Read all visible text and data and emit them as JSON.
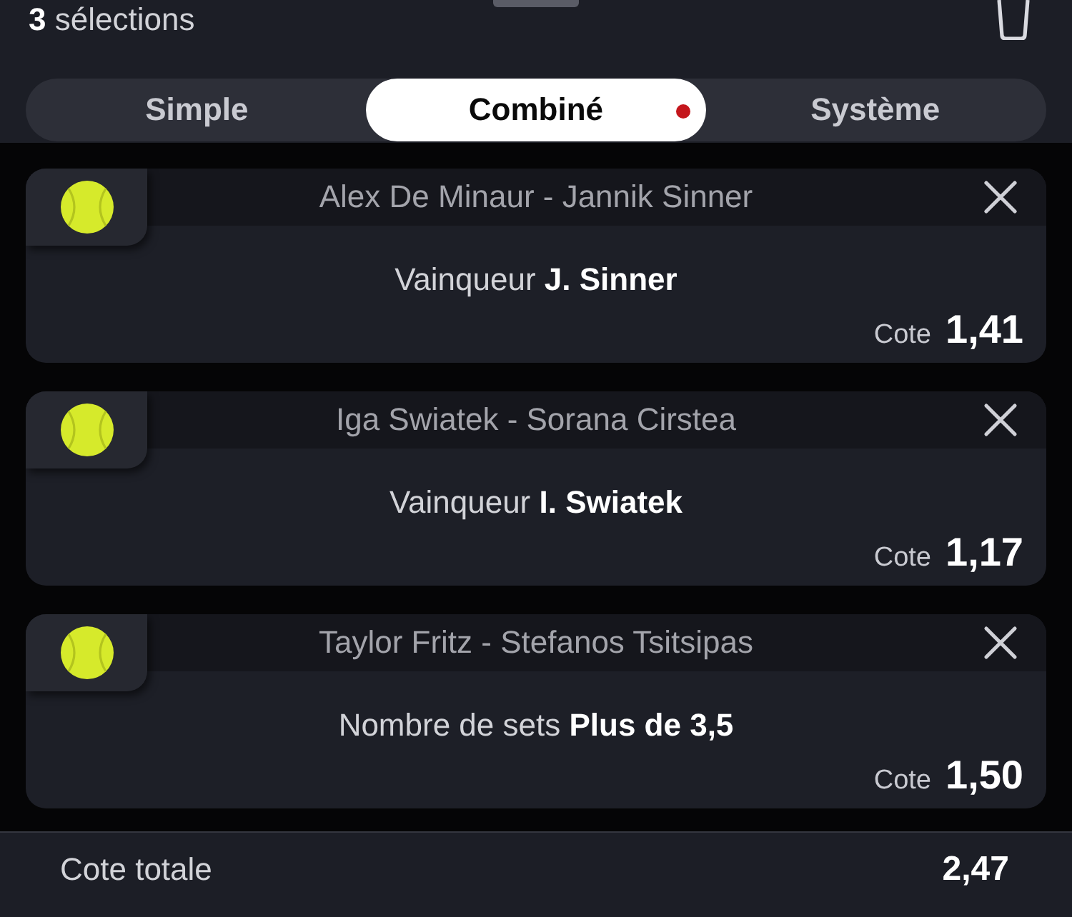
{
  "header": {
    "title": "**3** sélections"
  },
  "tabs": [
    {
      "label": "Simple",
      "selected": false,
      "dot": false
    },
    {
      "label": "Combiné",
      "selected": true,
      "dot": true
    },
    {
      "label": "Système",
      "selected": false,
      "dot": false
    }
  ],
  "bets": [
    {
      "match": "Alex De Minaur - Jannik Sinner",
      "selection": "Vainqueur **J. Sinner**",
      "odds_label": "Cote",
      "odds": "1,41"
    },
    {
      "match": "Iga Swiatek - Sorana Cirstea",
      "selection": "Vainqueur **I. Swiatek**",
      "odds_label": "Cote",
      "odds": "1,17"
    },
    {
      "match": "Taylor Fritz - Stefanos Tsitsipas",
      "selection": "Nombre de sets **Plus de 3,5**",
      "odds_label": "Cote",
      "odds": "1,50"
    }
  ],
  "footer": {
    "label": "Cote totale",
    "value": "2,47"
  }
}
